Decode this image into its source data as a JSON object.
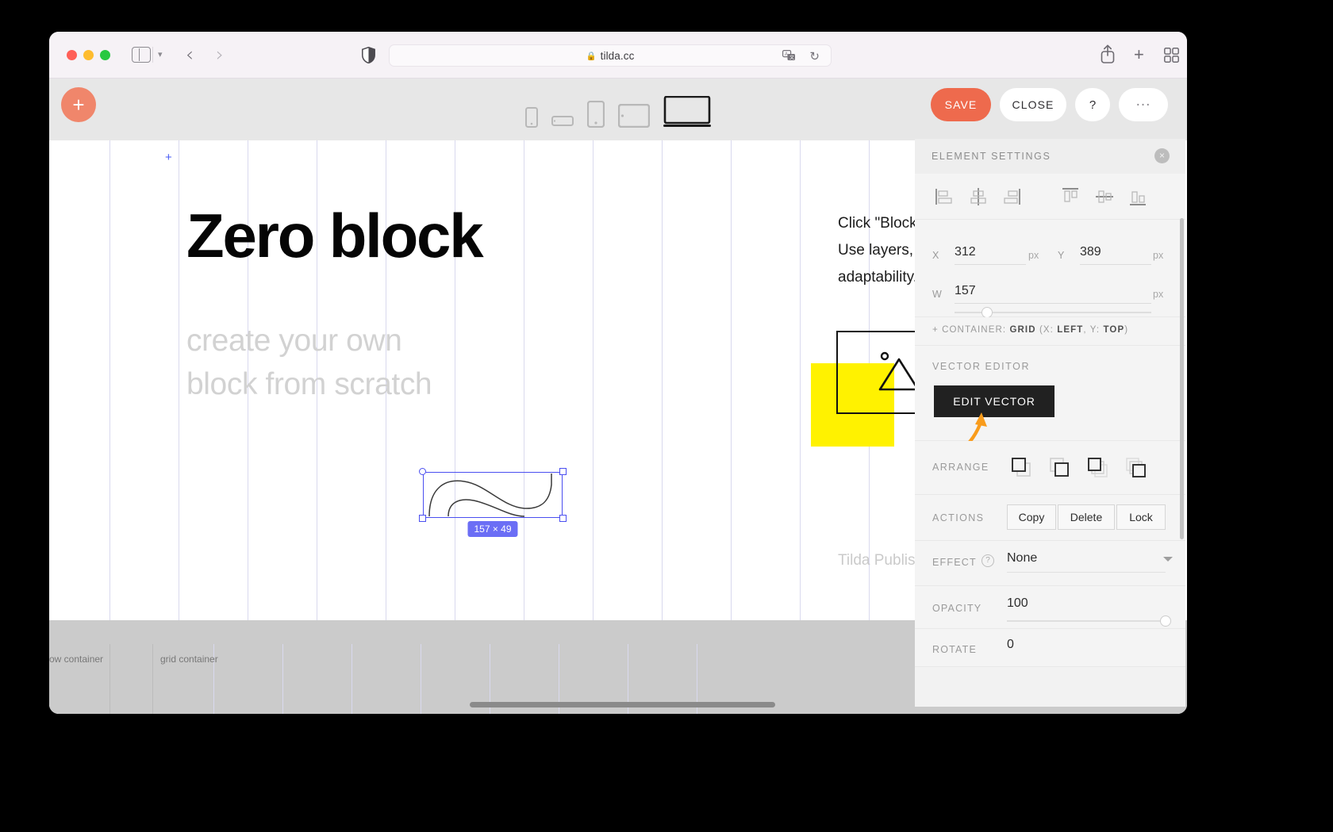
{
  "browser": {
    "url": "tilda.cc",
    "lock_glyph": "ὑ2",
    "icons": {
      "sidebar": "sidebar-icon",
      "chevron": "chevron-down-icon",
      "back": "‹",
      "forward": "›",
      "shield": "shield-icon",
      "translate": "translate-icon",
      "reload": "↻",
      "share": "share-icon",
      "newtab": "+",
      "tabgrid": "tab-overview-icon"
    }
  },
  "tilda_toolbar": {
    "add_block": "+",
    "devices": [
      {
        "name": "phone-small",
        "selected": false
      },
      {
        "name": "phone-landscape",
        "selected": false
      },
      {
        "name": "phone-large",
        "selected": false
      },
      {
        "name": "tablet",
        "selected": false
      },
      {
        "name": "desktop",
        "selected": true
      }
    ],
    "save_label": "SAVE",
    "close_label": "CLOSE",
    "help_label": "?",
    "more_label": "...",
    "save_color": "#ee6a4d"
  },
  "canvas": {
    "plus_marker": "+",
    "title": "Zero block",
    "subtitle_line1": "create your own",
    "subtitle_line2": "block from scratch",
    "paragraph_line1": "Click \"Block Editor",
    "paragraph_line2": "Use layers, shapes",
    "paragraph_line3": "adaptability. Every",
    "footer_text": "Tilda Publishing",
    "yellow_color": "#fff200",
    "selection": {
      "size_badge": "157 × 49",
      "accent": "#4a4ef0"
    },
    "strip": {
      "row_container": "ow container",
      "grid_container": "grid container"
    }
  },
  "panel": {
    "title": "ELEMENT SETTINGS",
    "close_glyph": "×",
    "align": [
      {
        "name": "align-left",
        "label": "align left"
      },
      {
        "name": "align-horizontal-center",
        "label": "align horizontal center"
      },
      {
        "name": "align-right",
        "label": "align right"
      },
      {
        "name": "align-top",
        "label": "align top"
      },
      {
        "name": "align-vertical-center",
        "label": "align vertical center"
      },
      {
        "name": "align-bottom",
        "label": "align bottom"
      }
    ],
    "coords": {
      "x_label": "X",
      "x_value": "312",
      "x_unit": "px",
      "y_label": "Y",
      "y_value": "389",
      "y_unit": "px",
      "w_label": "W",
      "w_value": "157",
      "w_unit": "px"
    },
    "container_prefix": "+ CONTAINER:",
    "container_type": "GRID",
    "container_detail_open": "(X:",
    "container_x": "LEFT",
    "container_comma": ", Y:",
    "container_y": "TOP",
    "container_detail_close": ")",
    "vector_editor_label": "VECTOR EDITOR",
    "edit_vector_label": "EDIT VECTOR",
    "annotation_arrow_color": "#f99c1c",
    "arrange_label": "ARRANGE",
    "arrange_options": [
      "bring-to-front",
      "send-to-back",
      "bring-forward",
      "send-backward"
    ],
    "actions_label": "ACTIONS",
    "actions": [
      {
        "name": "copy-button",
        "label": "Copy"
      },
      {
        "name": "delete-button",
        "label": "Delete"
      },
      {
        "name": "lock-button",
        "label": "Lock"
      }
    ],
    "effect_label": "EFFECT",
    "effect_help": "?",
    "effect_value": "None",
    "opacity_label": "OPACITY",
    "opacity_value": "100",
    "rotate_label": "ROTATE",
    "rotate_value": "0"
  }
}
